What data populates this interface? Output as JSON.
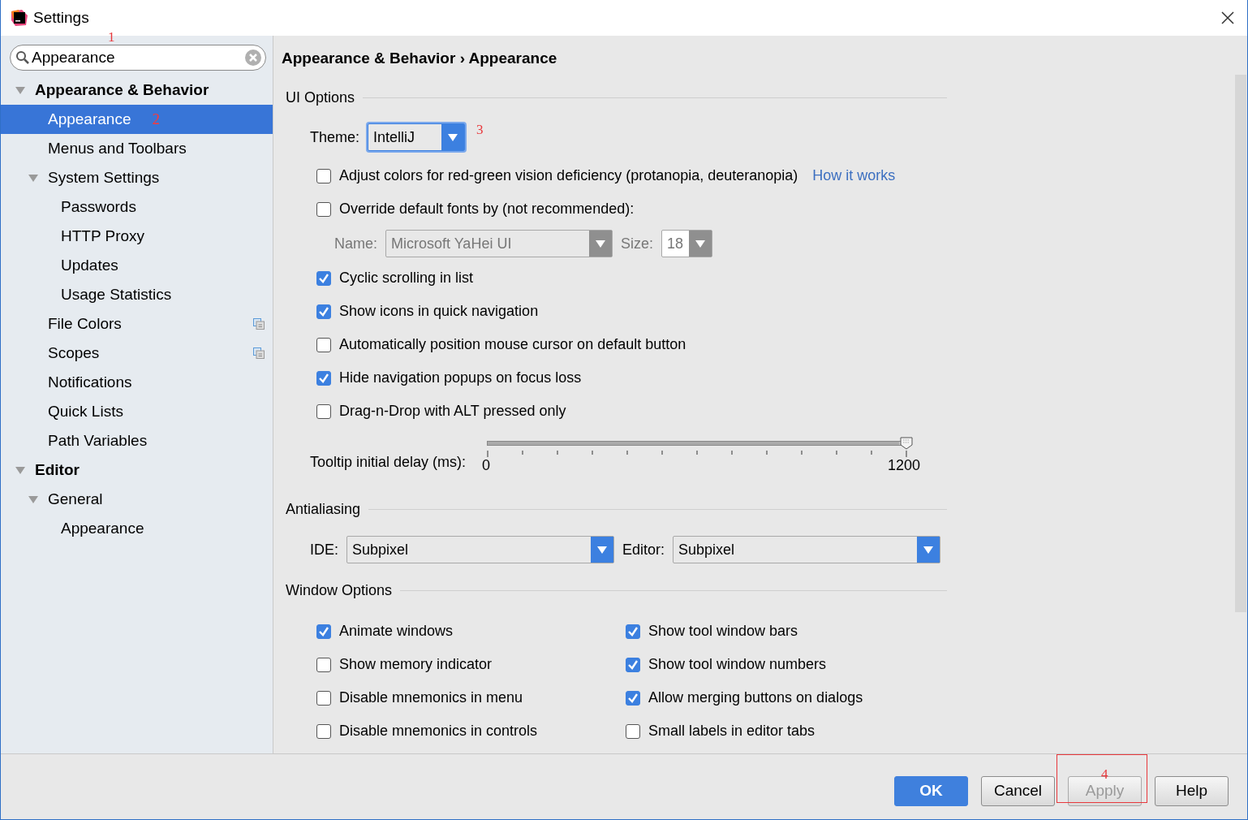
{
  "window": {
    "title": "Settings"
  },
  "search": {
    "value": "Appearance",
    "annotation": "1"
  },
  "sidebar": {
    "tree": [
      {
        "label": "Appearance & Behavior",
        "bold": true,
        "expanded": true,
        "selected": false,
        "children": [
          {
            "label": "Appearance",
            "selected": true,
            "shared": false,
            "annotation": "2"
          },
          {
            "label": "Menus and Toolbars",
            "selected": false,
            "shared": false
          },
          {
            "label": "System Settings",
            "selected": false,
            "shared": false,
            "expanded": true,
            "children": [
              {
                "label": "Passwords",
                "selected": false
              },
              {
                "label": "HTTP Proxy",
                "selected": false
              },
              {
                "label": "Updates",
                "selected": false
              },
              {
                "label": "Usage Statistics",
                "selected": false
              }
            ]
          },
          {
            "label": "File Colors",
            "selected": false,
            "shared": true
          },
          {
            "label": "Scopes",
            "selected": false,
            "shared": true
          },
          {
            "label": "Notifications",
            "selected": false,
            "shared": false
          },
          {
            "label": "Quick Lists",
            "selected": false,
            "shared": false
          },
          {
            "label": "Path Variables",
            "selected": false,
            "shared": false
          }
        ]
      },
      {
        "label": "Editor",
        "bold": true,
        "expanded": true,
        "selected": false,
        "children": [
          {
            "label": "General",
            "selected": false,
            "expanded": true,
            "children": [
              {
                "label": "Appearance",
                "selected": false
              }
            ]
          }
        ]
      }
    ]
  },
  "breadcrumb": "Appearance & Behavior › Appearance",
  "sections": [
    {
      "title": "UI Options",
      "rows": [
        {
          "kind": "dropdown",
          "label": "Theme:",
          "value": "IntelliJ",
          "focused": true,
          "annotation": "3"
        },
        {
          "kind": "checkbox",
          "label": "Adjust colors for red-green vision deficiency (protanopia, deuteranopia)",
          "checked": false,
          "link": "How it works"
        },
        {
          "kind": "checkbox",
          "label": "Override default fonts by (not recommended):",
          "checked": false
        },
        {
          "kind": "font",
          "disabled": true,
          "name_label": "Name:",
          "name": "Microsoft YaHei UI",
          "size_label": "Size:",
          "size": "18"
        },
        {
          "kind": "checkbox",
          "label": "Cyclic scrolling in list",
          "checked": true
        },
        {
          "kind": "checkbox",
          "label": "Show icons in quick navigation",
          "checked": true
        },
        {
          "kind": "checkbox",
          "label": "Automatically position mouse cursor on default button",
          "checked": false
        },
        {
          "kind": "checkbox",
          "label": "Hide navigation popups on focus loss",
          "checked": true
        },
        {
          "kind": "checkbox",
          "label": "Drag-n-Drop with ALT pressed only",
          "checked": false
        },
        {
          "kind": "slider",
          "label": "Tooltip initial delay (ms):",
          "level": 1,
          "min_label": "0",
          "max_label": "1200"
        }
      ]
    },
    {
      "title": "Antialiasing",
      "rows": [
        {
          "kind": "pair",
          "fields": [
            {
              "label": "IDE:",
              "value": "Subpixel"
            },
            {
              "label": "Editor:",
              "value": "Subpixel"
            }
          ]
        }
      ]
    },
    {
      "title": "Window Options",
      "rows": [
        {
          "kind": "columns",
          "columns": [
            [
              {
                "label": "Animate windows",
                "checked": true
              },
              {
                "label": "Show memory indicator",
                "checked": false
              },
              {
                "label": "Disable mnemonics in menu",
                "checked": false
              },
              {
                "label": "Disable mnemonics in controls",
                "checked": false
              }
            ],
            [
              {
                "label": "Show tool window bars",
                "checked": true
              },
              {
                "label": "Show tool window numbers",
                "checked": true
              },
              {
                "label": "Allow merging buttons on dialogs",
                "checked": true
              },
              {
                "label": "Small labels in editor tabs",
                "checked": false
              }
            ]
          ]
        }
      ]
    }
  ],
  "buttons": [
    {
      "label": "OK",
      "kind": "primary",
      "disabled": false
    },
    {
      "label": "Cancel",
      "kind": "normal",
      "disabled": false
    },
    {
      "label": "Apply",
      "kind": "normal",
      "disabled": true,
      "annotation": "4"
    },
    {
      "label": "Help",
      "kind": "normal",
      "disabled": false
    }
  ]
}
